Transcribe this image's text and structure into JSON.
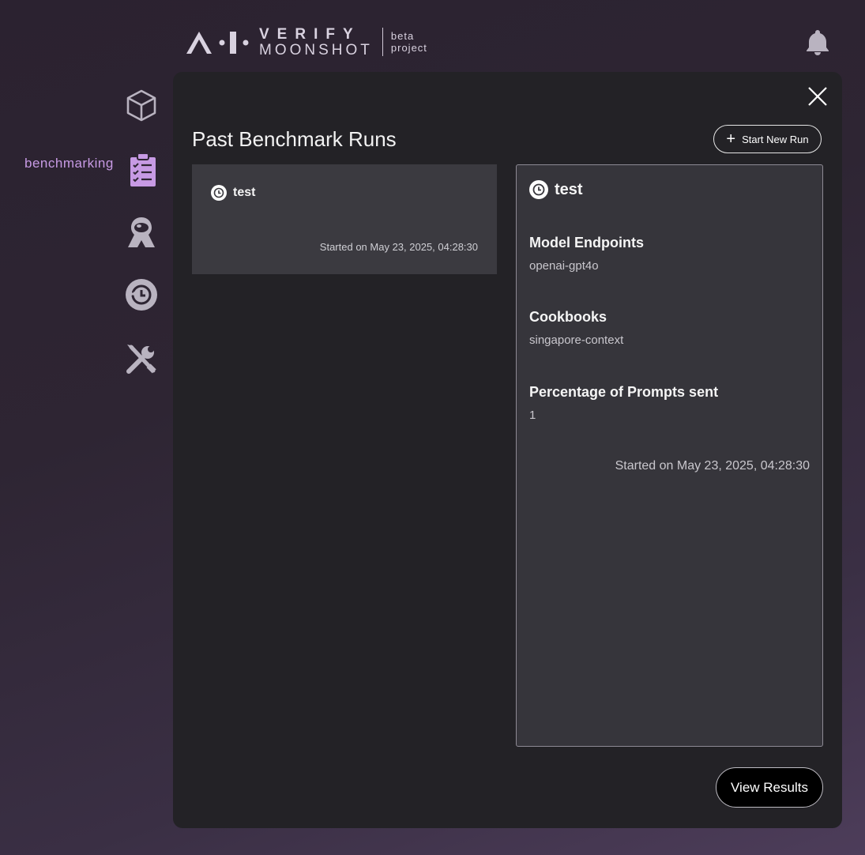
{
  "header": {
    "logo_word_1": "VERIFY",
    "logo_word_2": "MOONSHOT",
    "badge_line_1": "beta",
    "badge_line_2": "project",
    "bell_icon": "bell-icon"
  },
  "sidebar": {
    "items": [
      {
        "icon": "cube-icon",
        "label": ""
      },
      {
        "icon": "clipboard-checklist-icon",
        "label": "benchmarking",
        "active": true
      },
      {
        "icon": "astronaut-icon",
        "label": ""
      },
      {
        "icon": "history-icon",
        "label": ""
      },
      {
        "icon": "tools-icon",
        "label": ""
      }
    ],
    "active_color": "#c79ae4",
    "icon_color": "#b9b3c0"
  },
  "panel": {
    "title": "Past Benchmark Runs",
    "start_button_label": "Start New Run",
    "runs": [
      {
        "name": "test",
        "started": "Started on May 23, 2025, 04:28:30"
      }
    ],
    "detail": {
      "name": "test",
      "model_endpoints_label": "Model Endpoints",
      "model_endpoints_value": "openai-gpt4o",
      "cookbooks_label": "Cookbooks",
      "cookbooks_value": "singapore-context",
      "prompts_label": "Percentage of Prompts sent",
      "prompts_value": "1",
      "started": "Started on May 23, 2025, 04:28:30"
    },
    "view_results_label": "View Results"
  }
}
